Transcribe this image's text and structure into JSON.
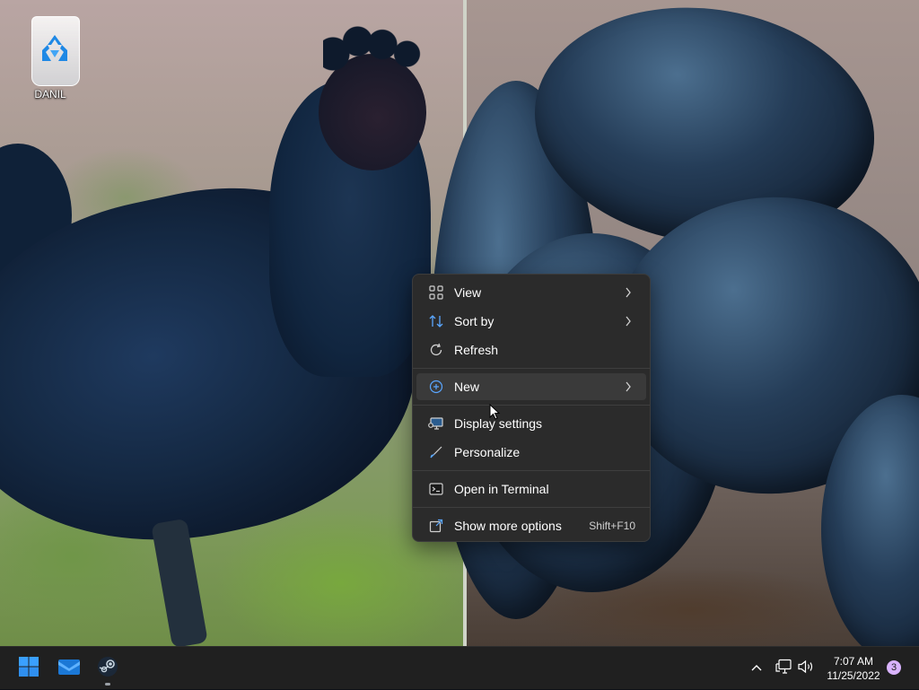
{
  "desktop": {
    "icons": [
      {
        "label": "DANIL",
        "icon": "recycle-bin-icon"
      }
    ]
  },
  "context_menu": {
    "items": [
      {
        "id": "view",
        "label": "View",
        "icon": "grid-view-icon",
        "has_submenu": true
      },
      {
        "id": "sort-by",
        "label": "Sort by",
        "icon": "sort-icon",
        "has_submenu": true
      },
      {
        "id": "refresh",
        "label": "Refresh",
        "icon": "refresh-icon",
        "has_submenu": false
      },
      {
        "id": "new",
        "label": "New",
        "icon": "plus-circle-icon",
        "has_submenu": true,
        "highlighted": true
      },
      {
        "id": "display-settings",
        "label": "Display settings",
        "icon": "display-icon",
        "has_submenu": false
      },
      {
        "id": "personalize",
        "label": "Personalize",
        "icon": "brush-icon",
        "has_submenu": false
      },
      {
        "id": "open-in-terminal",
        "label": "Open in Terminal",
        "icon": "terminal-icon",
        "has_submenu": false
      },
      {
        "id": "show-more-options",
        "label": "Show more options",
        "icon": "share-icon",
        "shortcut": "Shift+F10",
        "has_submenu": false
      }
    ]
  },
  "taskbar": {
    "apps": [
      {
        "name": "Start",
        "icon": "windows-logo-icon"
      },
      {
        "name": "Mail",
        "icon": "mail-icon"
      },
      {
        "name": "Steam",
        "icon": "steam-icon",
        "running": true
      }
    ],
    "tray": {
      "icons": [
        "chevron-up-icon",
        "network-icon",
        "volume-icon"
      ],
      "time": "7:07 AM",
      "date": "11/25/2022",
      "notification_count": "3"
    }
  },
  "colors": {
    "menu_bg": "#2b2b2b",
    "menu_hover": "#3a3a3a",
    "taskbar_bg": "#202020",
    "accent": "#0078d4",
    "badge": "#d9b3ff"
  }
}
